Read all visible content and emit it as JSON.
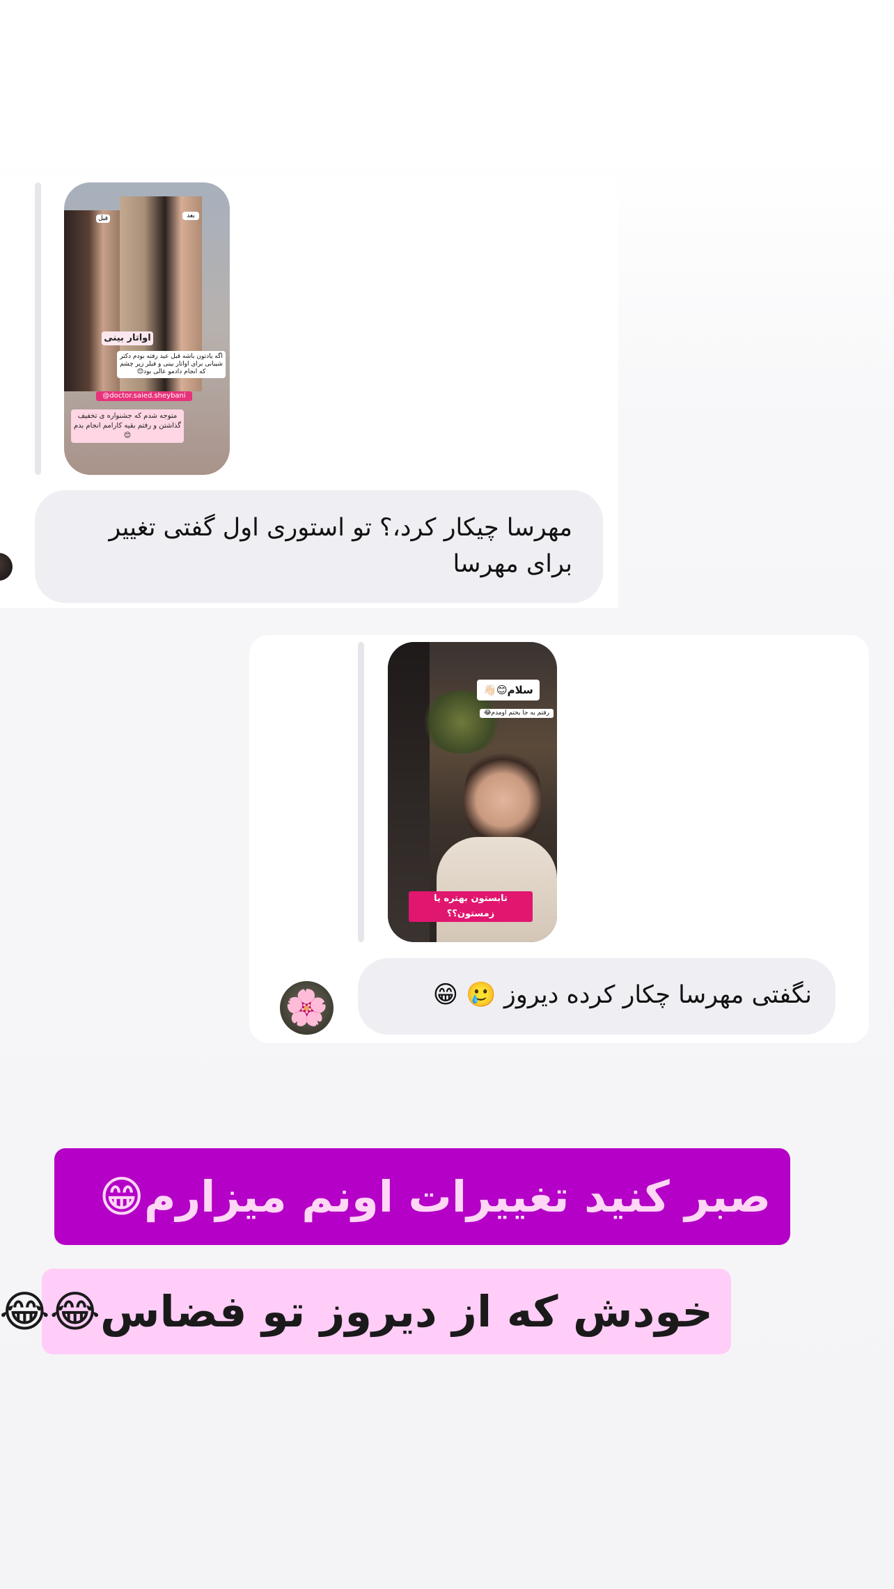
{
  "thread": {
    "message_1": {
      "story_reply": {
        "label_before": "قبل",
        "label_after": "بعد",
        "title_sticker": "اواتار بینی",
        "text_sticker": "اگه یادتون باشه قبل عید رفته بودم دکتر شیبانی برای اواتار بینی و فیلر زیر چشم که انجام دادمو عالی بود😊",
        "mention": "@doctor.saied.sheybani",
        "bottom_sticker": "متوجه شدم که جشنواره ی تخفیف گذاشتن و رفتم بقیه کارامم انجام بدم😊"
      },
      "text": "مهرسا چیکار کرد،؟ تو استوری اول گفتی تغییر برای مهرسا"
    },
    "message_2": {
      "story_reply": {
        "greeting_sticker": "سلام😊👋🏻",
        "sub_sticker": "رفتم یه جا یختم اومدم😂",
        "question_sticker": "تابستون بهتره یا زمستون؟؟"
      },
      "text": "نگفتی مهرسا چکار کرده دیروز 🥲 😁",
      "avatar_emoji": "🌸"
    }
  },
  "overlay_captions": {
    "line_1": "صبر کنید تغییرات اونم میزارم😁",
    "line_2": "خودش که از دیروز تو فضاس😂😂"
  },
  "colors": {
    "caption_1_bg": "#b400c7",
    "caption_1_text": "#ffd7f5",
    "caption_2_bg": "#ffcdf7",
    "bubble_bg": "#efeff3",
    "mention_tag": "#e8327a"
  }
}
